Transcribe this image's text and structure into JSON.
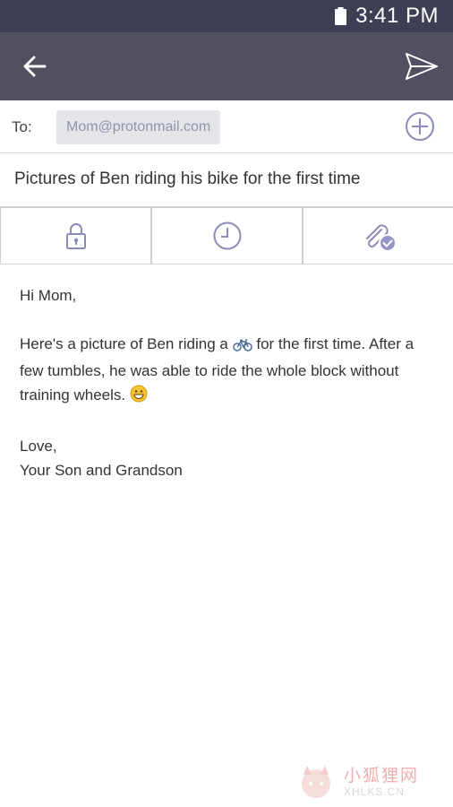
{
  "status_bar": {
    "time": "3:41 PM",
    "battery_icon": "battery-icon"
  },
  "app_bar": {
    "back_icon": "arrow-left-icon",
    "send_icon": "send-icon",
    "background": "#505061"
  },
  "compose": {
    "to_label": "To:",
    "recipient": "Mom@protonmail.com",
    "add_icon": "plus-circle-icon",
    "subject": "Pictures of Ben riding his bike for the first time"
  },
  "options": [
    {
      "name": "encryption",
      "icon": "lock-icon"
    },
    {
      "name": "expiration",
      "icon": "clock-icon"
    },
    {
      "name": "attachments",
      "icon": "paperclip-icon",
      "badge_icon": "check-badge-icon"
    }
  ],
  "body": {
    "greeting": "Hi Mom,",
    "paragraph_start": "Here's a picture of Ben riding a",
    "paragraph_end": "for the first time. After a few tumbles, he was able to ride the whole block without training wheels.",
    "closing": "Love,",
    "signature": "Your Son and Grandson"
  },
  "watermark": {
    "chinese": "小狐狸网",
    "url": "XHLKS.CN"
  },
  "colors": {
    "accent": "#9497c8",
    "icon": "#8a8cb8",
    "chip_text": "#8f94a8"
  }
}
